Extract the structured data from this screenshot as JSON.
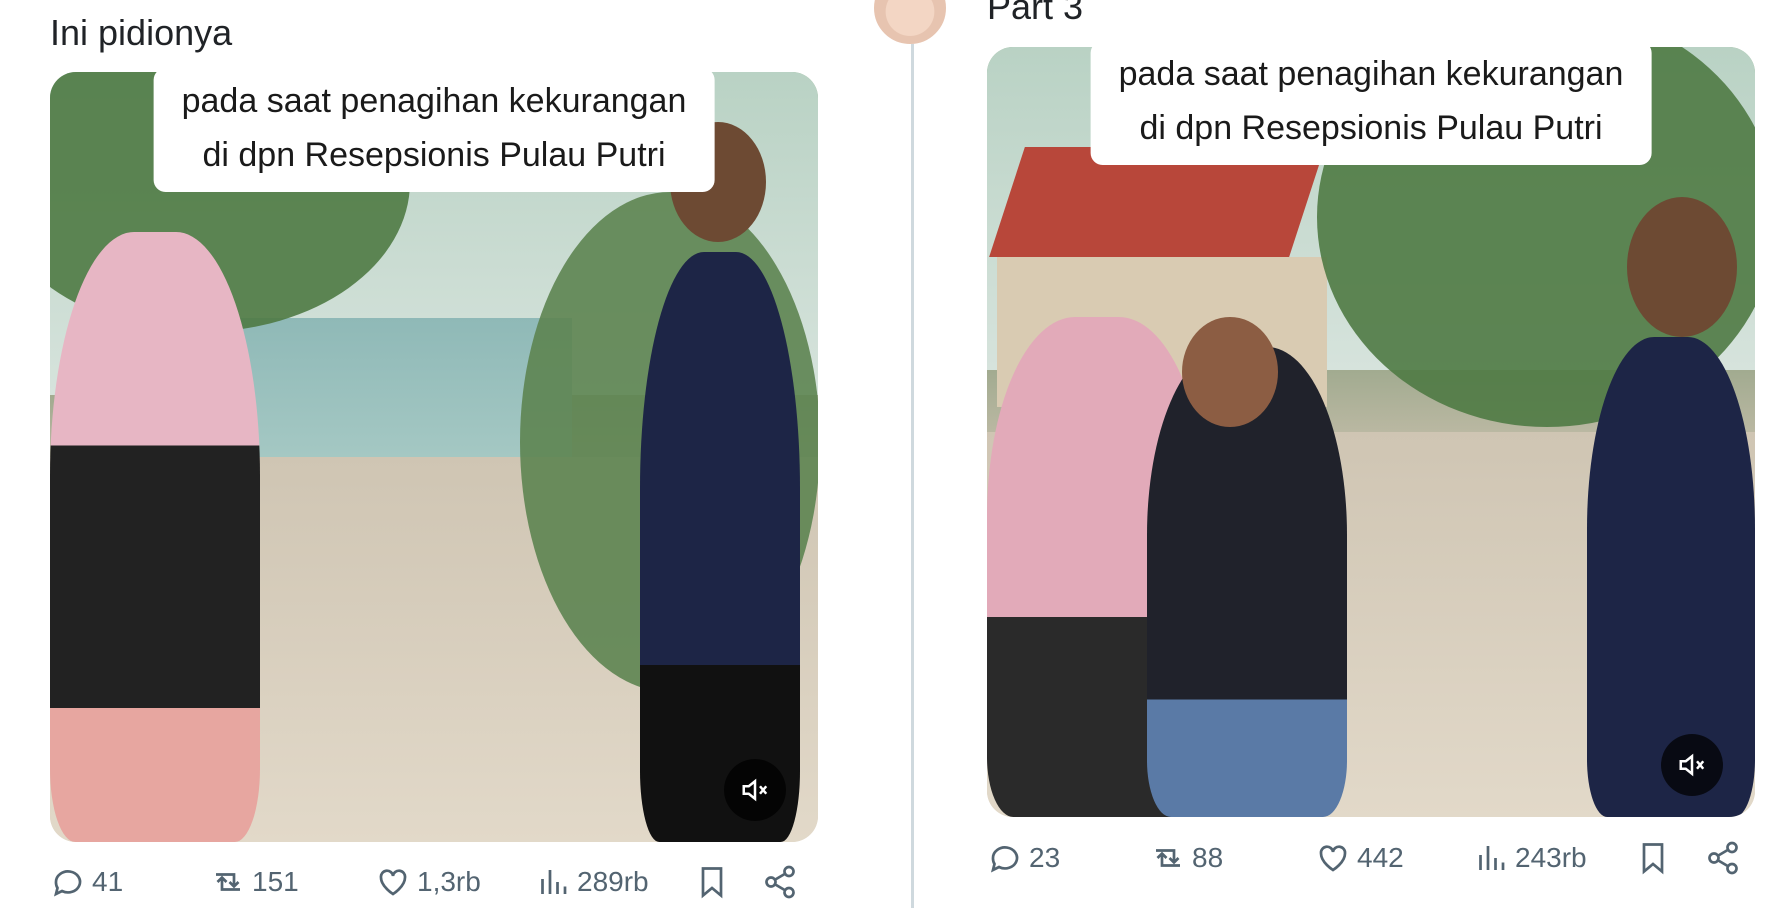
{
  "posts": [
    {
      "caption": "Ini pidionya",
      "video_text": {
        "line1": "pada saat penagihan kekurangan",
        "line2": "di dpn Resepsionis Pulau Putri"
      },
      "stats": {
        "replies": "41",
        "reposts": "151",
        "likes": "1,3rb",
        "views": "289rb"
      }
    },
    {
      "caption": "Part 3",
      "video_text": {
        "line1": "pada saat penagihan kekurangan",
        "line2": "di dpn Resepsionis Pulau Putri"
      },
      "stats": {
        "replies": "23",
        "reposts": "88",
        "likes": "442",
        "views": "243rb"
      }
    }
  ],
  "icons": {
    "reply": "reply-icon",
    "repost": "repost-icon",
    "like": "heart-icon",
    "views": "views-chart-icon",
    "bookmark": "bookmark-icon",
    "share": "share-icon",
    "mute": "mute-icon"
  },
  "colors": {
    "icon": "#536471",
    "divider": "#cfd9de",
    "overlay_button": "#000000"
  }
}
